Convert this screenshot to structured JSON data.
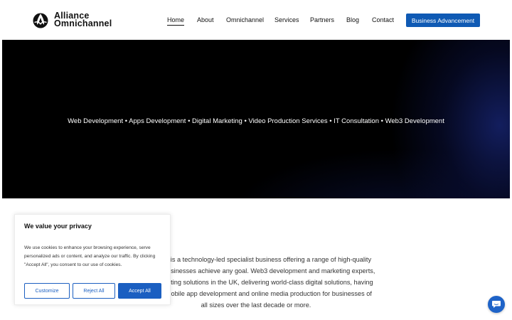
{
  "brand": {
    "line1": "Alliance",
    "line2": "Omnichannel",
    "logo_icon": "alliance-logo-icon"
  },
  "nav": {
    "items": [
      {
        "label": "Home",
        "active": true
      },
      {
        "label": "About",
        "active": false
      },
      {
        "label": "Omnichannel",
        "active": false
      },
      {
        "label": "Services",
        "active": false
      },
      {
        "label": "Partners",
        "active": false
      },
      {
        "label": "Blog",
        "active": false
      },
      {
        "label": "Contact",
        "active": false
      }
    ],
    "cta_label": "Business Advancement"
  },
  "hero": {
    "tagline": "Web Development • Apps Development • Digital Marketing  • Video Production Services • IT Consultation • Web3 Development"
  },
  "intro": {
    "lines": [
      "el Limited is a technology-led specialist business offering a range of high-quality",
      "s to help businesses achieve any goal. Web3 development and marketing experts,",
      "p IT consulting solutions in the UK, delivering world-class digital solutions, having",
      "mmerce/mobile app development and online media production for businesses of",
      "all sizes over the last decade or more."
    ]
  },
  "cookie_banner": {
    "title": "We value your privacy",
    "text": "We use cookies to enhance your browsing experience, serve personalized ads or content, and analyze our traffic. By clicking \"Accept All\", you consent to our use of cookies.",
    "customize_label": "Customize",
    "reject_label": "Reject All",
    "accept_label": "Accept All"
  },
  "chat_widget": {
    "icon": "chat-bubble-icon"
  },
  "colors": {
    "accent": "#0f5ab4",
    "hero_bg": "#000000",
    "cookie_button": "#1b5fc1"
  }
}
